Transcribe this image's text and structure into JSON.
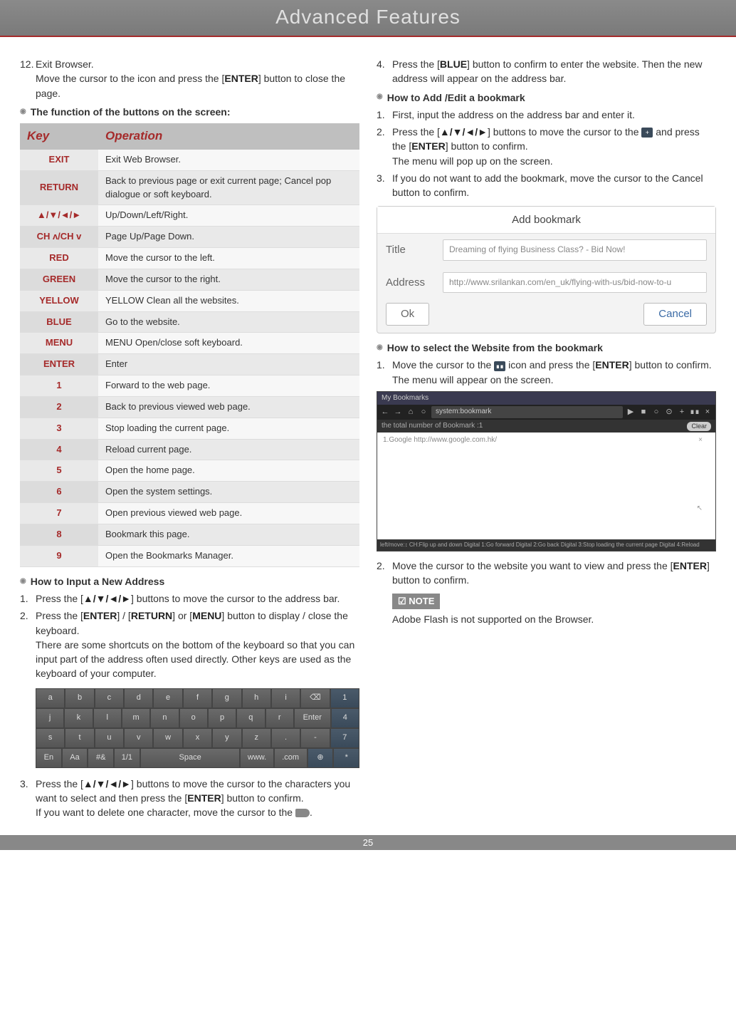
{
  "header": "Advanced Features",
  "page_number": "25",
  "left": {
    "item12_num": "12.",
    "item12_title": "Exit Browser.",
    "item12_body": "Move the cursor to the icon and press the [ENTER] button to close the page.",
    "subhead_functions": "The function of the buttons on the screen:",
    "table": {
      "col1": "Key",
      "col2": "Operation",
      "rows": [
        {
          "k": "EXIT",
          "op": "Exit Web Browser."
        },
        {
          "k": "RETURN",
          "op": "Back to previous page or exit current page; Cancel pop dialogue or soft keyboard."
        },
        {
          "k": "▲/▼/◄/►",
          "op": "Up/Down/Left/Right."
        },
        {
          "k": "CH ʌ/CH v",
          "op": "Page Up/Page Down."
        },
        {
          "k": "RED",
          "op": "Move the cursor to the left."
        },
        {
          "k": "GREEN",
          "op": "Move the cursor to the right."
        },
        {
          "k": "YELLOW",
          "op": "YELLOW Clean all the websites."
        },
        {
          "k": "BLUE",
          "op": "Go to the website."
        },
        {
          "k": "MENU",
          "op": "MENU Open/close soft keyboard."
        },
        {
          "k": "ENTER",
          "op": "Enter"
        },
        {
          "k": "1",
          "op": "Forward to the web page."
        },
        {
          "k": "2",
          "op": "Back to previous viewed web page."
        },
        {
          "k": "3",
          "op": "Stop loading the current page."
        },
        {
          "k": "4",
          "op": "Reload current page."
        },
        {
          "k": "5",
          "op": "Open the home page."
        },
        {
          "k": "6",
          "op": "Open the system settings."
        },
        {
          "k": "7",
          "op": "Open previous viewed web page."
        },
        {
          "k": "8",
          "op": "Bookmark this page."
        },
        {
          "k": "9",
          "op": "Open the Bookmarks Manager."
        }
      ]
    },
    "subhead_input": "How to Input a New Address",
    "s1_num": "1.",
    "s1": "Press the [▲/▼/◄/►] buttons to move the cursor to the address bar.",
    "s2_num": "2.",
    "s2a": "Press the [ENTER] / [RETURN] or [MENU] button to display / close the keyboard.",
    "s2b": "There are some shortcuts on the bottom of the keyboard so that you can input part of the address often used directly. Other keys are used as the keyboard of your computer.",
    "keyboard": {
      "r1": [
        "a",
        "b",
        "c",
        "d",
        "e",
        "f",
        "g",
        "h",
        "i",
        "⌫",
        "1"
      ],
      "r2": [
        "j",
        "k",
        "l",
        "m",
        "n",
        "o",
        "p",
        "q",
        "r",
        "Enter",
        "4"
      ],
      "r3": [
        "s",
        "t",
        "u",
        "v",
        "w",
        "x",
        "y",
        "z",
        ".",
        "-",
        "7"
      ],
      "r4": [
        "En",
        "Aa",
        "#&",
        "1/1",
        "Space",
        "www.",
        ".com",
        "⊕",
        "*"
      ]
    },
    "s3_num": "3.",
    "s3a": "Press the [▲/▼/◄/►] buttons to move the cursor to the characters you want to select and then press the [ENTER] button to confirm.",
    "s3b_pre": "If you want to delete one character, move the cursor to the ",
    "s3b_post": "."
  },
  "right": {
    "s4_num": "4.",
    "s4": "Press the [BLUE] button to confirm to enter the website. Then the new address will appear on the address bar.",
    "subhead_addedit": "How to Add /Edit a bookmark",
    "a1_num": "1.",
    "a1": "First, input the address on the address bar and enter it.",
    "a2_num": "2.",
    "a2a_pre": "Press the [▲/▼/◄/►] buttons to move the cursor to the ",
    "a2a_post": " and press the [ENTER] button to confirm.",
    "a2b": "The menu will pop up on the screen.",
    "a3_num": "3.",
    "a3": "If you do not want to add the bookmark, move the cursor to the Cancel button to confirm.",
    "addbm": {
      "title": "Add bookmark",
      "title_label": "Title",
      "title_val": "Dreaming of flying Business Class? - Bid Now!",
      "addr_label": "Address",
      "addr_val": "http://www.srilankan.com/en_uk/flying-with-us/bid-now-to-u",
      "ok": "Ok",
      "cancel": "Cancel"
    },
    "subhead_select": "How to select the Website from the bookmark",
    "b1_num": "1.",
    "b1_pre": "Move the cursor to the ",
    "b1_post": " icon and press the [ENTER] button to confirm. The menu will appear on the screen.",
    "bmwin": {
      "titlebar": "My Bookmarks",
      "url": "system:bookmark",
      "line2_left": "the total number of Bookmark :1",
      "clear": "Clear",
      "entry": "1.Google http://www.google.com.hk/",
      "status": "left/move:↕   CH:Flip up and down   Digital 1:Go forward   Digital 2:Go back   Digital 3:Stop loading the current page   Digital 4:Reload"
    },
    "b2_num": "2.",
    "b2": "Move the cursor to the website you want to view and press the [ENTER] button to confirm.",
    "note_label": "NOTE",
    "note_text": "Adobe Flash is not supported on the Browser."
  }
}
